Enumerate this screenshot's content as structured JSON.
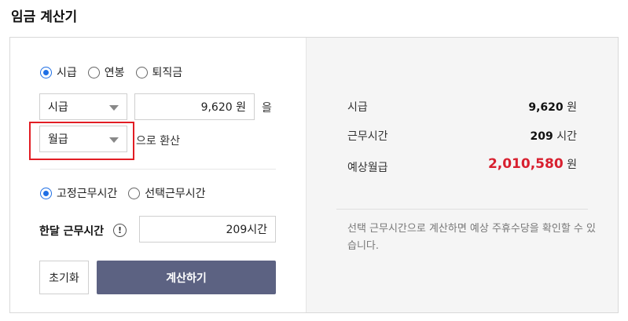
{
  "title": "임금 계산기",
  "wage_type_radios": [
    {
      "label": "시급",
      "checked": true
    },
    {
      "label": "연봉",
      "checked": false
    },
    {
      "label": "퇴직금",
      "checked": false
    }
  ],
  "from_select": {
    "value": "시급"
  },
  "amount_input": {
    "value": "9,620 원"
  },
  "particle": "을",
  "to_select": {
    "value": "월급"
  },
  "convert_text": "으로 환산",
  "hours_type_radios": [
    {
      "label": "고정근무시간",
      "checked": true
    },
    {
      "label": "선택근무시간",
      "checked": false
    }
  ],
  "monthly_hours": {
    "label": "한달 근무시간",
    "info_icon": "!",
    "value": "209시간"
  },
  "buttons": {
    "reset": "초기화",
    "calculate": "계산하기"
  },
  "results": [
    {
      "label": "시급",
      "value": "9,620",
      "unit": "원"
    },
    {
      "label": "근무시간",
      "value": "209",
      "unit": "시간"
    },
    {
      "label": "예상월급",
      "value": "2,010,580",
      "unit": "원"
    }
  ],
  "note": "선택 근무시간으로 계산하면 예상 주휴수당을 확인할 수 있습니다.",
  "colors": {
    "accent": "#1f6fe5",
    "button": "#5c6282",
    "highlight": "#e21d24",
    "result_emphasis": "#d8202f"
  }
}
